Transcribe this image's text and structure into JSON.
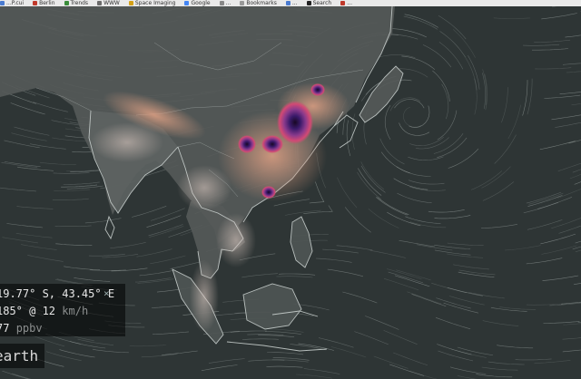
{
  "bookmarks": [
    {
      "label": "...P.cui",
      "color": "#4a7bd0"
    },
    {
      "label": "Berlin",
      "color": "#c0392b"
    },
    {
      "label": "Trends",
      "color": "#3a8d3a"
    },
    {
      "label": "WWW",
      "color": "#6b6b6b"
    },
    {
      "label": "Space Imaging",
      "color": "#d4a017"
    },
    {
      "label": "Google",
      "color": "#4285f4"
    },
    {
      "label": "...",
      "color": "#888888"
    },
    {
      "label": "Bookmarks",
      "color": "#999999"
    },
    {
      "label": "...",
      "color": "#4a7bd0"
    },
    {
      "label": "Search",
      "color": "#222222"
    },
    {
      "label": "...",
      "color": "#c0392b"
    }
  ],
  "readout": {
    "location": "19.77° S, 43.45° E",
    "close": "×",
    "wind_value": "185° @ 12",
    "wind_unit": "km/h",
    "overlay_value": "77",
    "overlay_unit": "ppbv"
  },
  "menu_button": "earth",
  "colors": {
    "ocean": "#2e3535",
    "land": "#5b6160",
    "coastline": "#cfd6d4",
    "overlay_low": "#d9a78a",
    "overlay_mid": "#d24a74",
    "overlay_high": "#5a2a9a",
    "overlay_max": "#180824"
  }
}
